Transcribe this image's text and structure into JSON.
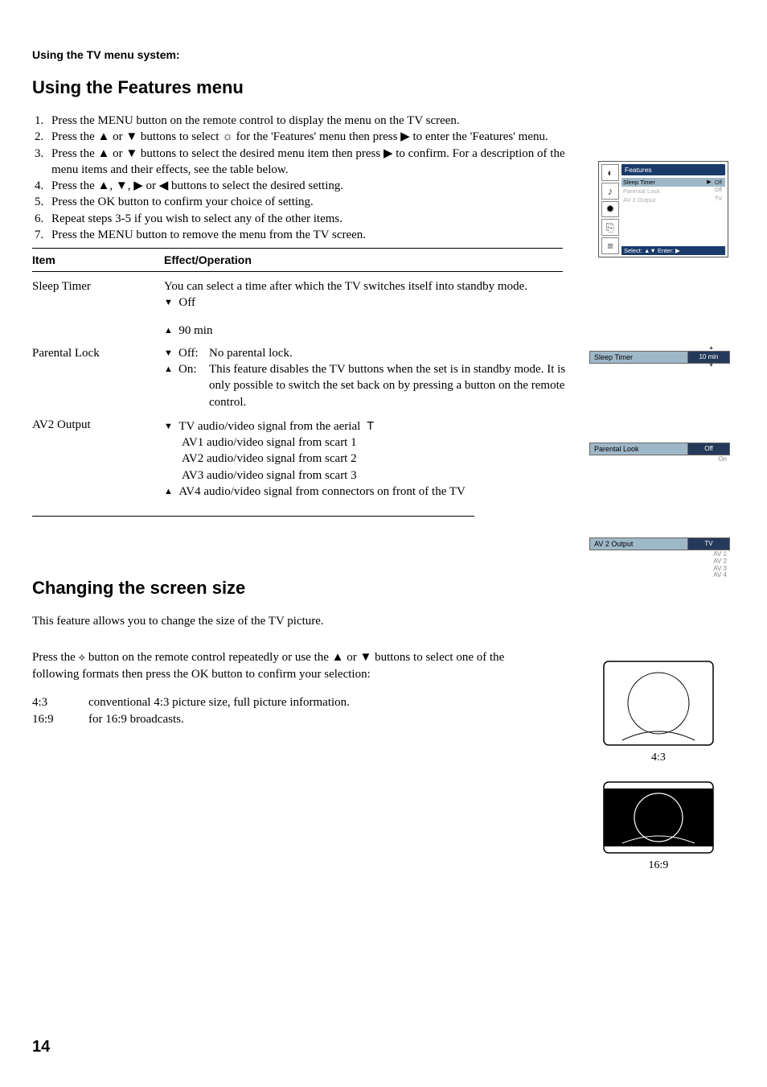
{
  "header": {
    "section_title": "Using the TV menu system:"
  },
  "main_title": "Using the Features menu",
  "steps": [
    "Press the MENU button on the remote control to display the menu on the TV screen.",
    "Press the ▲ or ▼ buttons to select  ☼  for the 'Features' menu then press ▶ to enter the 'Features' menu.",
    "Press the ▲ or ▼ buttons to select the desired menu item then press ▶ to confirm.  For a description of the menu items and their effects, see the table below.",
    "Press the ▲, ▼, ▶ or ◀ buttons to select the desired setting.",
    "Press the OK button to confirm your choice of setting.",
    "Repeat steps 3-5 if you wish to select any of the other items.",
    "Press the MENU button to remove the menu from the TV screen."
  ],
  "table_head": {
    "c1": "Item",
    "c2": "Effect/Operation"
  },
  "items": {
    "sleep": {
      "name": "Sleep Timer",
      "desc": "You can select a time after which the TV switches itself into standby mode.",
      "down": "Off",
      "up": "90 min"
    },
    "parental": {
      "name": "Parental Lock",
      "off_label": "Off:",
      "off_text": "No parental lock.",
      "on_label": "On:",
      "on_text": "This feature disables the TV buttons when the set is in standby mode. It is only possible to switch the set back on by pressing a button on the remote control."
    },
    "av2": {
      "name": "AV2 Output",
      "l1": "TV audio/video signal from the aerial",
      "l2": "AV1 audio/video signal from scart 1",
      "l3": "AV2 audio/video signal from scart 2",
      "l4": "AV3 audio/video signal from scart 3",
      "l5": "AV4 audio/video signal from connectors on front of the TV"
    }
  },
  "osd": {
    "title": "Features",
    "rows": [
      {
        "label": "Sleep Timer",
        "value": "Off",
        "highlight": true,
        "arrow": true
      },
      {
        "label": "Parental Lock",
        "value": "Off",
        "highlight": false
      },
      {
        "label": "AV 2 Output",
        "value": "TV",
        "highlight": false
      }
    ],
    "footer": "Select: ▲▼ Enter: ▶"
  },
  "valboxes": {
    "sleep": {
      "label": "Sleep Timer",
      "value": "10 min"
    },
    "parental": {
      "label": "Parental Look",
      "value": "Off",
      "opts": [
        "On"
      ]
    },
    "av2": {
      "label": "AV 2 Output",
      "value": "TV",
      "opts": [
        "AV 1",
        "AV 2",
        "AV 3",
        "AV 4"
      ]
    }
  },
  "screen": {
    "title": "Changing the screen size",
    "intro": "This feature allows you to change the size of the TV picture.",
    "instr_pre": "Press the ",
    "instr_post": " button on the remote control repeatedly or use the ▲ or ▼ buttons to select one of the following formats then press the OK button to confirm your selection:",
    "formats": [
      {
        "k": "4:3",
        "v": "conventional 4:3 picture size, full picture information."
      },
      {
        "k": "16:9",
        "v": "for 16:9 broadcasts."
      }
    ],
    "ratio43": "4:3",
    "ratio169": "16:9"
  },
  "page_number": "14"
}
